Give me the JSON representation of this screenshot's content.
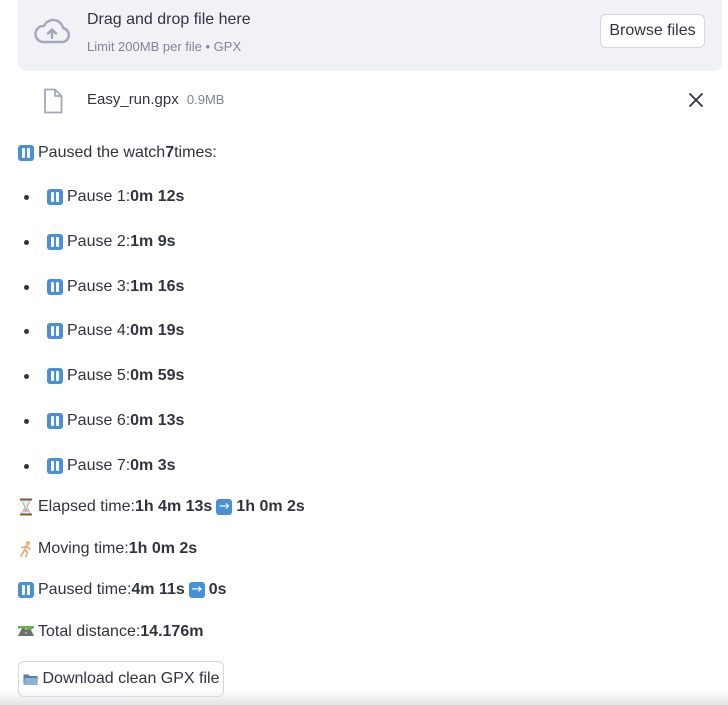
{
  "uploader": {
    "title": "Drag and drop file here",
    "limit": "Limit 200MB per file • GPX",
    "browse_label": "Browse files",
    "icon": "cloud-upload-icon"
  },
  "file": {
    "name": "Easy_run.gpx",
    "size": "0.9MB",
    "icon": "file-icon",
    "remove_icon": "close-icon"
  },
  "summary": {
    "paused_prefix": "Paused the watch ",
    "paused_count": "7",
    "paused_suffix": " times:"
  },
  "pauses": [
    {
      "label": "Pause 1: ",
      "duration": "0m 12s"
    },
    {
      "label": "Pause 2: ",
      "duration": "1m 9s"
    },
    {
      "label": "Pause 3: ",
      "duration": "1m 16s"
    },
    {
      "label": "Pause 4: ",
      "duration": "0m 19s"
    },
    {
      "label": "Pause 5: ",
      "duration": "0m 59s"
    },
    {
      "label": "Pause 6: ",
      "duration": "0m 13s"
    },
    {
      "label": "Pause 7: ",
      "duration": "0m 3s"
    }
  ],
  "elapsed": {
    "label": "Elapsed time: ",
    "before": "1h 4m 13s",
    "after": "1h 0m 2s"
  },
  "moving": {
    "label": "Moving time: ",
    "value": "1h 0m 2s"
  },
  "paused_time": {
    "label": "Paused time: ",
    "before": "4m 11s",
    "after": "0s"
  },
  "distance": {
    "label": "Total distance: ",
    "value": "14.176m"
  },
  "download": {
    "label": "Download clean GPX file"
  },
  "colors": {
    "dropzone_bg": "#f0f2f6",
    "text": "#31333f",
    "muted": "#808495",
    "emoji_blue": "#4a90d9"
  }
}
